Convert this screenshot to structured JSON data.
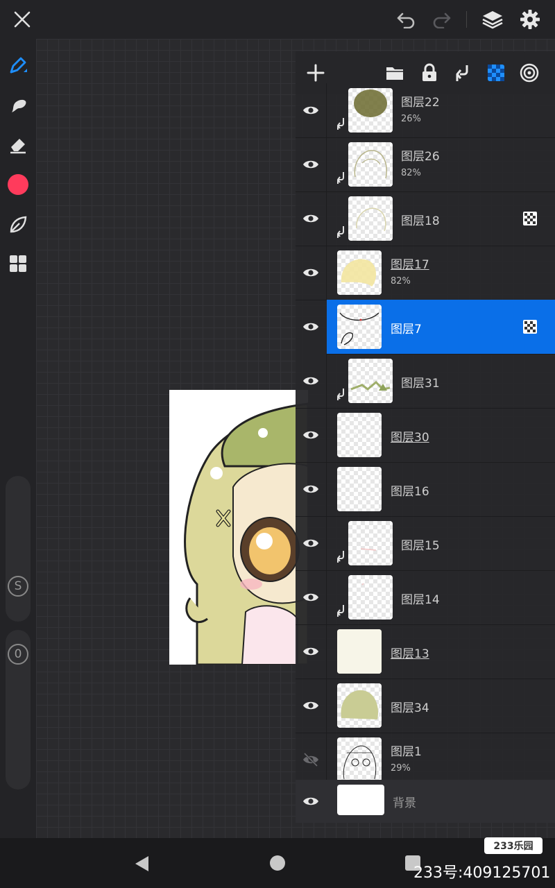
{
  "top_bar": {
    "icons": [
      "close-icon",
      "undo-icon",
      "redo-icon",
      "layers-icon",
      "settings-icon"
    ]
  },
  "left_toolbar": {
    "tools": [
      "pen-icon",
      "smudge-icon",
      "eraser-icon",
      "color-swatch",
      "leaf-icon",
      "grid-icon"
    ],
    "color": "#ff3b5c",
    "size_slider_label": "S",
    "opacity_slider_label": "0"
  },
  "layers_panel": {
    "header_icons": [
      "add-icon",
      "folder-icon",
      "lock-icon",
      "merge-down-icon",
      "alpha-lock-icon",
      "target-icon"
    ],
    "layers": [
      {
        "name": "图层22",
        "opacity": "26%",
        "clipped": true,
        "underline": false,
        "alpha_lock": false,
        "active": false,
        "visible": true
      },
      {
        "name": "图层26",
        "opacity": "82%",
        "clipped": true,
        "underline": false,
        "alpha_lock": false,
        "active": false,
        "visible": true
      },
      {
        "name": "图层18",
        "opacity": "",
        "clipped": true,
        "underline": false,
        "alpha_lock": true,
        "active": false,
        "visible": true
      },
      {
        "name": "图层17",
        "opacity": "82%",
        "clipped": false,
        "underline": true,
        "alpha_lock": false,
        "active": false,
        "visible": true
      },
      {
        "name": "图层7",
        "opacity": "",
        "clipped": false,
        "underline": false,
        "alpha_lock": true,
        "active": true,
        "visible": true
      },
      {
        "name": "图层31",
        "opacity": "",
        "clipped": true,
        "underline": false,
        "alpha_lock": false,
        "active": false,
        "visible": true
      },
      {
        "name": "图层30",
        "opacity": "",
        "clipped": false,
        "underline": true,
        "alpha_lock": false,
        "active": false,
        "visible": true
      },
      {
        "name": "图层16",
        "opacity": "",
        "clipped": false,
        "underline": false,
        "alpha_lock": false,
        "active": false,
        "visible": true
      },
      {
        "name": "图层15",
        "opacity": "",
        "clipped": true,
        "underline": false,
        "alpha_lock": false,
        "active": false,
        "visible": true
      },
      {
        "name": "图层14",
        "opacity": "",
        "clipped": true,
        "underline": false,
        "alpha_lock": false,
        "active": false,
        "visible": true
      },
      {
        "name": "图层13",
        "opacity": "",
        "clipped": false,
        "underline": true,
        "alpha_lock": false,
        "active": false,
        "visible": true
      },
      {
        "name": "图层34",
        "opacity": "",
        "clipped": false,
        "underline": false,
        "alpha_lock": false,
        "active": false,
        "visible": true
      },
      {
        "name": "图层1",
        "opacity": "29%",
        "clipped": false,
        "underline": false,
        "alpha_lock": false,
        "active": false,
        "visible": false
      }
    ],
    "background_layer": {
      "name": "背景"
    }
  },
  "nav_bar": {
    "icons": [
      "back-icon",
      "home-icon",
      "recents-icon"
    ]
  },
  "watermark": {
    "badge": "233乐园",
    "text": "233号:409125701"
  }
}
